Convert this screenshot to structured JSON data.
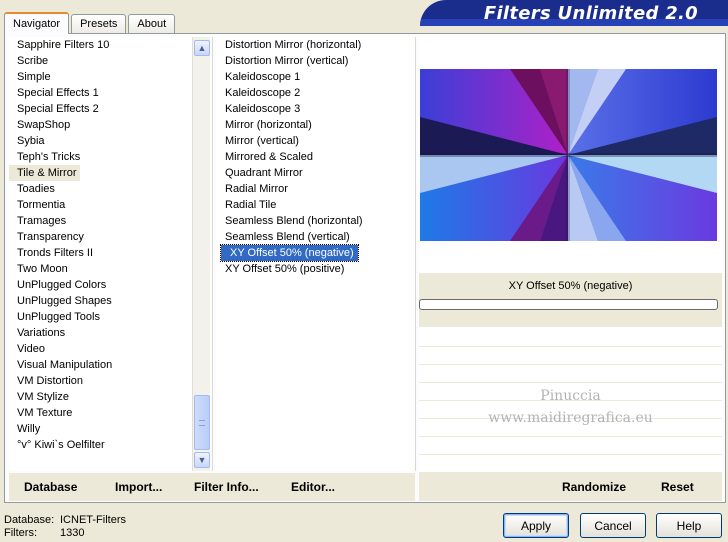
{
  "tabs": [
    "Navigator",
    "Presets",
    "About"
  ],
  "banner_title": "Filters Unlimited 2.0",
  "categories": [
    "Sapphire Filters 10",
    "Scribe",
    "Simple",
    "Special Effects 1",
    "Special Effects 2",
    "SwapShop",
    "Sybia",
    "Teph's Tricks",
    "Tile & Mirror",
    "Toadies",
    "Tormentia",
    "Tramages",
    "Transparency",
    "Tronds Filters II",
    "Two Moon",
    "UnPlugged Colors",
    "UnPlugged Shapes",
    "UnPlugged Tools",
    "Variations",
    "Video",
    "Visual Manipulation",
    "VM Distortion",
    "VM Stylize",
    "VM Texture",
    "Willy",
    "°v° Kiwi`s Oelfilter"
  ],
  "highlighted_category": "Tile & Mirror",
  "filters": [
    "Distortion Mirror (horizontal)",
    "Distortion Mirror (vertical)",
    "Kaleidoscope 1",
    "Kaleidoscope 2",
    "Kaleidoscope 3",
    "Mirror (horizontal)",
    "Mirror (vertical)",
    "Mirrored & Scaled",
    "Quadrant Mirror",
    "Radial Mirror",
    "Radial Tile",
    "Seamless Blend (horizontal)",
    "Seamless Blend (vertical)",
    "XY Offset 50% (negative)",
    "XY Offset 50% (positive)"
  ],
  "selected_filter": "XY Offset 50% (negative)",
  "preview_filter_name": "XY Offset 50% (negative)",
  "progress": 0,
  "watermark": {
    "line1": "Pinuccia",
    "line2": "www.maidiregrafica.eu"
  },
  "bottom_links": {
    "database": "Database",
    "import": "Import...",
    "filter_info": "Filter Info...",
    "editor": "Editor...",
    "randomize": "Randomize",
    "reset": "Reset"
  },
  "footer": {
    "database_label": "Database:",
    "database_value": "ICNET-Filters",
    "filters_label": "Filters:",
    "filters_value": "1330"
  },
  "buttons": {
    "apply": "Apply",
    "cancel": "Cancel",
    "help": "Help"
  },
  "icons": {
    "scroll_up": "chevron-up-icon",
    "scroll_down": "chevron-down-icon"
  },
  "colors": {
    "banner": "#1a2d8c",
    "selection": "#316ac5",
    "tab_accent": "#e68b2c"
  }
}
